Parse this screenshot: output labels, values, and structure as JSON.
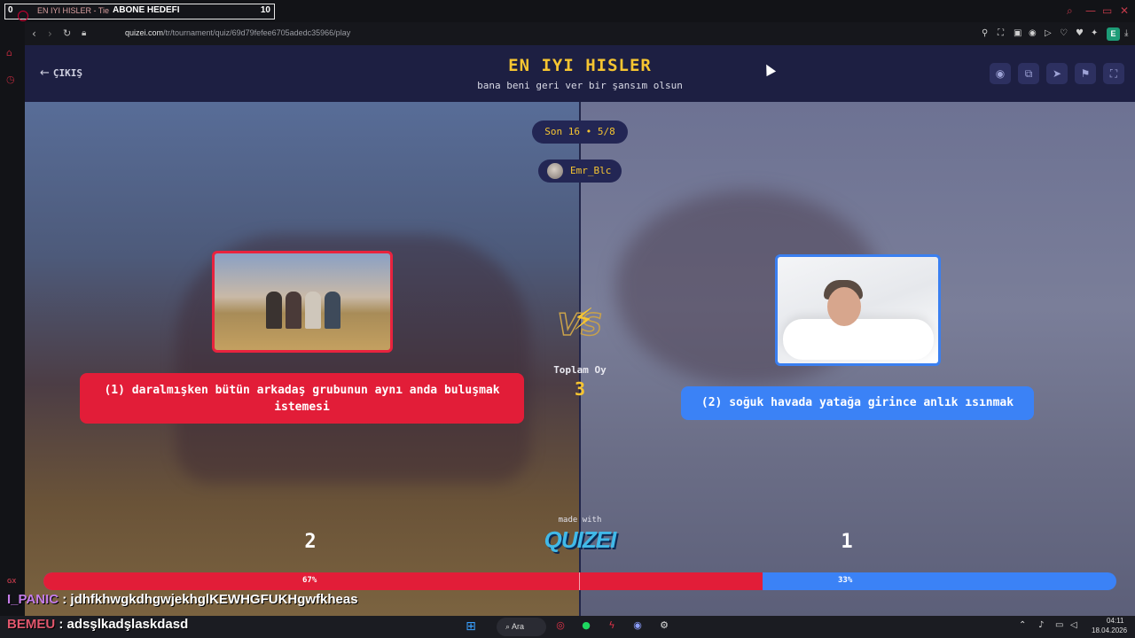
{
  "stream_overlay": {
    "left_count": "0",
    "tab_title": "EN IYI HISLER - Tie",
    "goal_label": "ABONE HEDEFI",
    "goal_count": "10"
  },
  "browser": {
    "url_domain": "quizei.com",
    "url_path": "/tr/tournament/quiz/69d79fefee6705adedc35966/play",
    "extension_badge": "E"
  },
  "sidebar": {
    "label": "GX"
  },
  "quiz": {
    "exit_label": "ÇIKIŞ",
    "title": "EN IYI HISLER",
    "subtitle": "bana beni geri ver bir şansım olsun",
    "round": "Son 16 • 5/8",
    "username": "Emr_Blc",
    "vs_text": "VS",
    "total_label": "Toplam Oy",
    "total_value": "3",
    "option1": {
      "label": "(1) daralmışken bütün arkadaş grubunun aynı anda buluşmak istemesi",
      "votes": "2",
      "percent_label": "67%",
      "color": "#e21d38"
    },
    "option2": {
      "label": "(2) soğuk havada yatağa girince anlık ısınmak",
      "votes": "1",
      "percent_label": "33%",
      "color": "#3b82f6"
    },
    "vote_fraction_option1": 0.67,
    "made_with": "made with",
    "logo": "QUIZEI"
  },
  "chat": [
    {
      "user": "I_PANIC",
      "message": " : jdhfkhwgkdhgwjekhglKEWHGFUKHgwfkheas"
    },
    {
      "user": "BEMEU",
      "message": " : adsşlkadşlaskdasd"
    }
  ],
  "taskbar": {
    "search_label": "Ara",
    "time": "04:11",
    "date": "18.04.2026"
  },
  "colors": {
    "accent_yellow": "#f6c531",
    "header_bg": "#1d1f42",
    "red": "#e21d38",
    "blue": "#3b82f6"
  }
}
